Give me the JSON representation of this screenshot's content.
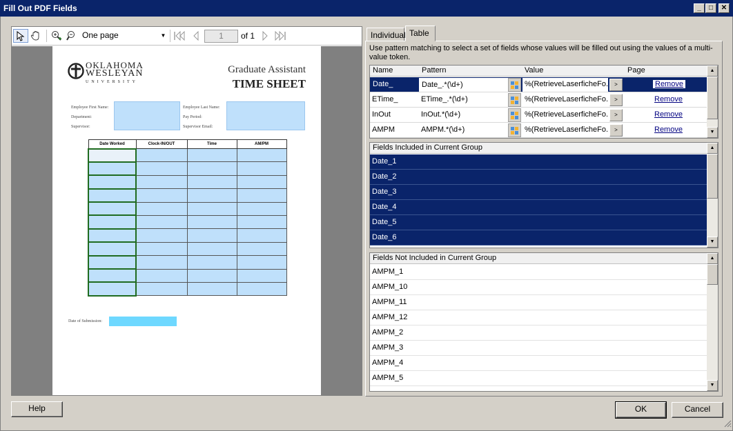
{
  "window": {
    "title": "Fill Out PDF Fields",
    "controls": {
      "minimize": "_",
      "maximize": "□",
      "close": "✕"
    }
  },
  "viewer": {
    "tools": [
      "pointer-icon",
      "hand-icon",
      "zoom-in-icon",
      "zoom-out-icon"
    ],
    "zoom_mode": "One page",
    "page_number": "1",
    "page_of": "of 1",
    "document": {
      "logo_line1": "OKLAHOMA",
      "logo_line2": "WESLEYAN",
      "logo_line3": "UNIVERSITY",
      "title_line1": "Graduate Assistant",
      "title_line2": "TIME SHEET",
      "labels": {
        "first_name": "Employee First Name:",
        "department": "Department:",
        "supervisor": "Supervisor:",
        "last_name": "Employee Last Name:",
        "pay_period": "Pay Period:",
        "supervisor_email": "Supervisor Email:",
        "date_of_submission": "Date of Submission:"
      },
      "table_headers": [
        "Date Worked",
        "Clock-IN/OUT",
        "Time",
        "AM/PM"
      ],
      "row_count": 11
    }
  },
  "tabs": {
    "individual": "Individual",
    "table": "Table",
    "active": "Table"
  },
  "table_tab": {
    "description": "Use pattern matching to select a set of fields whose values will be filled out using the values of a multi-value token.",
    "columns": {
      "name": "Name",
      "pattern": "Pattern",
      "value": "Value",
      "page": "Page"
    },
    "patterns": [
      {
        "name": "Date_",
        "pattern": "Date_.*(\\d+)",
        "value": "%(RetrieveLaserficheFo...",
        "page": "",
        "action": "Remove"
      },
      {
        "name": "ETime_",
        "pattern": "ETime_.*(\\d+)",
        "value": "%(RetrieveLaserficheFo...",
        "page": "",
        "action": "Remove"
      },
      {
        "name": "InOut",
        "pattern": "InOut.*(\\d+)",
        "value": "%(RetrieveLaserficheFo...",
        "page": "",
        "action": "Remove"
      },
      {
        "name": "AMPM",
        "pattern": "AMPM.*(\\d+)",
        "value": "%(RetrieveLaserficheFo...",
        "page": "",
        "action": "Remove"
      }
    ],
    "included_header": "Fields Included in Current Group",
    "included": [
      "Date_1",
      "Date_2",
      "Date_3",
      "Date_4",
      "Date_5",
      "Date_6"
    ],
    "not_included_header": "Fields Not Included in Current Group",
    "not_included": [
      "AMPM_1",
      "AMPM_10",
      "AMPM_11",
      "AMPM_12",
      "AMPM_2",
      "AMPM_3",
      "AMPM_4",
      "AMPM_5"
    ]
  },
  "footer": {
    "help": "Help",
    "ok": "OK",
    "cancel": "Cancel"
  },
  "colors": {
    "selection": "#0a246a",
    "field_fill": "#bfe0fb",
    "window_face": "#d4d0c8",
    "link": "#000080"
  }
}
